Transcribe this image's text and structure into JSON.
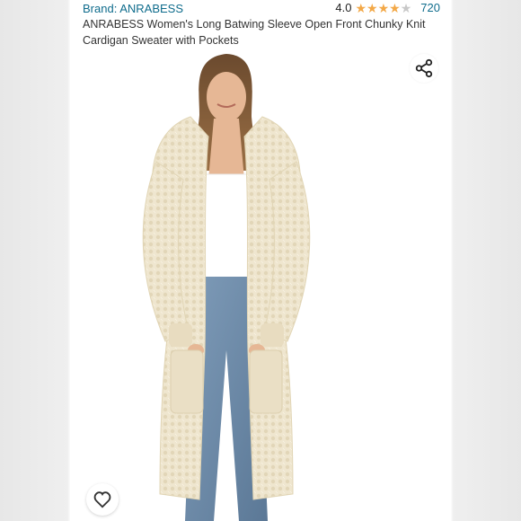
{
  "listing": {
    "brand_label": "Brand: ANRABESS",
    "rating_value": "4.0",
    "rating_stars": 4,
    "review_count": "720",
    "product_title": "ANRABESS Women's Long Batwing Sleeve Open Front Chunky Knit Cardigan Sweater with Pockets"
  },
  "icons": {
    "share": "share-icon",
    "favorite": "heart-icon",
    "star": "star-icon"
  },
  "colors": {
    "link_blue": "#0f6c8c",
    "star_gold": "#f3a847",
    "cardigan_cream": "#efe7d2"
  }
}
